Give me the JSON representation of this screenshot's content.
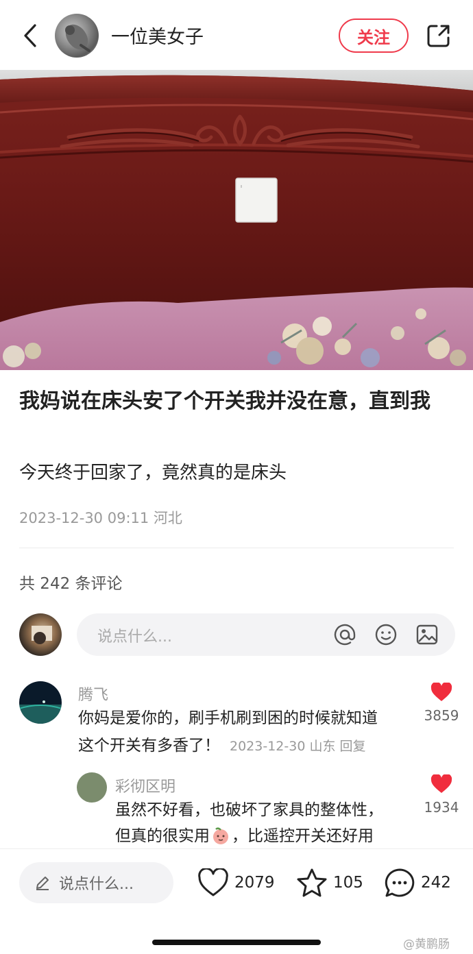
{
  "header": {
    "username": "一位美女子",
    "follow_label": "关注"
  },
  "post": {
    "title": "我妈说在床头安了个开关我并没在意，直到我",
    "body": "今天终于回家了，竟然真的是床头",
    "meta": "2023-12-30 09:11 河北"
  },
  "comments_section": {
    "count_label": "共 242 条评论",
    "input_placeholder": "说点什么...",
    "comments": [
      {
        "name": "腾飞",
        "line1": "你妈是爱你的，刷手机刷到困的时候就知道",
        "line2": "这个开关有多香了！",
        "meta": "2023-12-30 山东 回复",
        "likes": "3859"
      },
      {
        "name": "彩彻区明",
        "line1": "虽然不好看，也破坏了家具的整体性，",
        "line2a": "但真的很实用",
        "line2b": "，比遥控开关还好用",
        "likes": "1934"
      }
    ]
  },
  "bottom_bar": {
    "input_placeholder": "说点什么...",
    "likes": "2079",
    "favorites": "105",
    "comments": "242"
  },
  "watermark": "@黄鹏肠",
  "colors": {
    "accent": "#ef3a4b",
    "heart": "#f02d3d",
    "headboard": "#6b1c18",
    "sheet": "#c58aa8"
  }
}
